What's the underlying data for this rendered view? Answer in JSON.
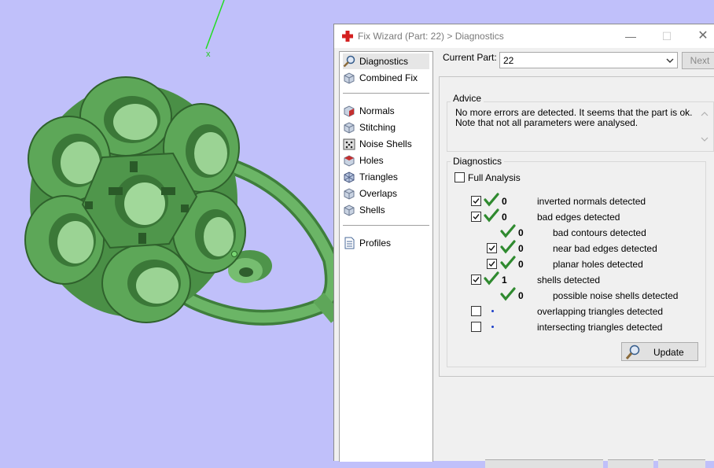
{
  "viewport": {
    "axis_label": "x",
    "background_color": "#c0c0fa",
    "model_color": "#5fa85a"
  },
  "window": {
    "title": "Fix Wizard (Part: 22) > Diagnostics",
    "minimize_glyph": "—",
    "maximize_glyph": "☐",
    "close_glyph": "✕"
  },
  "nav": {
    "items": [
      {
        "label": "Diagnostics",
        "icon": "magnifier-icon",
        "selected": true
      },
      {
        "label": "Combined Fix",
        "icon": "cube-icon"
      },
      {
        "label": "Normals",
        "icon": "normals-cube-icon"
      },
      {
        "label": "Stitching",
        "icon": "stitching-cube-icon"
      },
      {
        "label": "Noise Shells",
        "icon": "dice-icon"
      },
      {
        "label": "Holes",
        "icon": "holes-cube-icon"
      },
      {
        "label": "Triangles",
        "icon": "triangles-cube-icon"
      },
      {
        "label": "Overlaps",
        "icon": "overlaps-cube-icon"
      },
      {
        "label": "Shells",
        "icon": "shells-cube-icon"
      },
      {
        "label": "Profiles",
        "icon": "document-icon"
      }
    ]
  },
  "part": {
    "label": "Current Part:",
    "value": "22",
    "next_label": "Next"
  },
  "advice": {
    "title": "Advice",
    "line1": "No more errors are detected. It seems that the part is ok.",
    "line2": "Note that not all parameters were analysed."
  },
  "diagnostics": {
    "title": "Diagnostics",
    "full_analysis_label": "Full Analysis",
    "full_analysis_checked": false,
    "rows": [
      {
        "checked": true,
        "status": "ok",
        "count": "0",
        "label": "inverted normals detected",
        "indent": 0
      },
      {
        "checked": true,
        "status": "ok",
        "count": "0",
        "label": "bad edges detected",
        "indent": 0
      },
      {
        "checked": null,
        "status": "ok",
        "count": "0",
        "label": "bad contours detected",
        "indent": 1
      },
      {
        "checked": true,
        "status": "ok",
        "count": "0",
        "label": "near bad edges detected",
        "indent": 1
      },
      {
        "checked": true,
        "status": "ok",
        "count": "0",
        "label": "planar holes detected",
        "indent": 1
      },
      {
        "checked": true,
        "status": "ok",
        "count": "1",
        "label": "shells detected",
        "indent": 0
      },
      {
        "checked": null,
        "status": "ok",
        "count": "0",
        "label": "possible noise shells detected",
        "indent": 1
      },
      {
        "checked": false,
        "status": "pending",
        "count": "",
        "label": "overlapping triangles detected",
        "indent": 0
      },
      {
        "checked": false,
        "status": "pending",
        "count": "",
        "label": "intersecting triangles detected",
        "indent": 0
      }
    ],
    "update_label": "Update"
  },
  "colors": {
    "check_green": "#2f8a2f",
    "pending_dot": "#1e40c8",
    "title_red": "#d42020"
  }
}
